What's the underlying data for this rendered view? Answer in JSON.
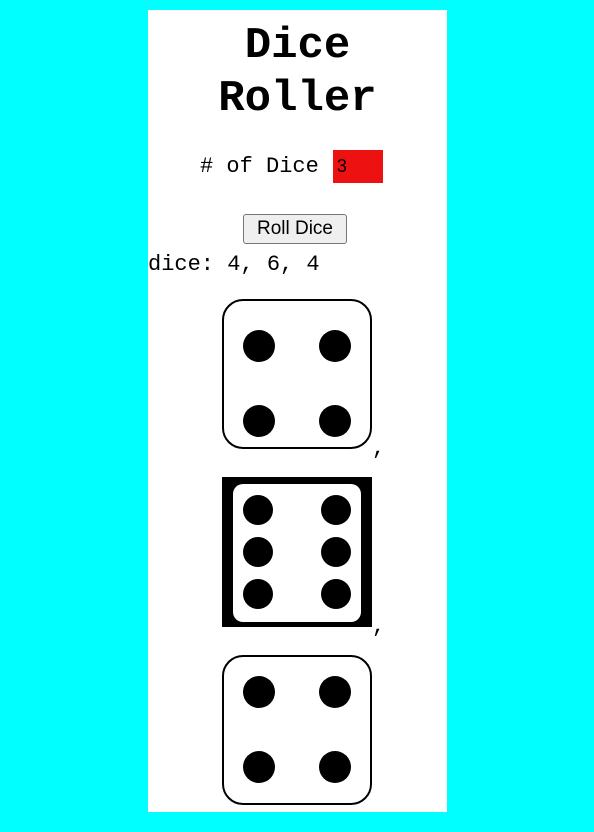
{
  "page": {
    "title_line1": "Dice",
    "title_line2": "Roller"
  },
  "controls": {
    "count_label": "# of Dice",
    "count_value": "3",
    "roll_button_label": "Roll Dice"
  },
  "result": {
    "text": "dice: 4, 6, 4",
    "values": [
      4,
      6,
      4
    ],
    "separator": ","
  },
  "colors": {
    "page_background": "#00ffff",
    "panel_background": "#ffffff",
    "input_background": "#ee1111"
  }
}
